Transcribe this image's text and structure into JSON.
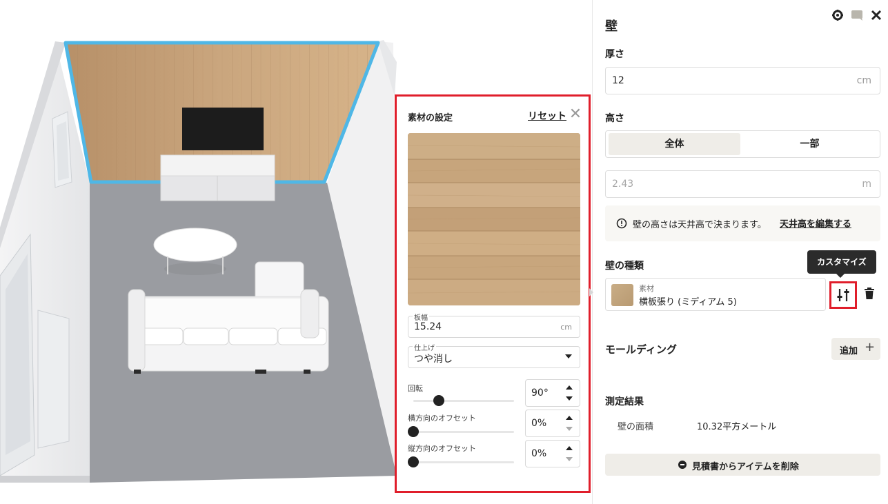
{
  "scene": {
    "name": "3d-room-view"
  },
  "material_panel": {
    "title": "素材の設定",
    "reset_label": "リセット",
    "close_glyph": "✕",
    "board_width": {
      "label": "板幅",
      "value": "15.24",
      "unit": "cm"
    },
    "finish": {
      "label": "仕上げ",
      "value": "つや消し"
    },
    "rotation": {
      "label": "回転",
      "value": "90°",
      "slider_fraction": 0.25
    },
    "horizontal_offset": {
      "label": "横方向のオフセット",
      "value": "0%",
      "slider_fraction": 0
    },
    "vertical_offset": {
      "label": "縦方向のオフセット",
      "value": "0%",
      "slider_fraction": 0
    }
  },
  "right_panel": {
    "title": "壁",
    "icons": [
      "gear-icon",
      "comment-icon",
      "close-icon"
    ],
    "thickness": {
      "label": "厚さ",
      "value": "12",
      "unit": "cm"
    },
    "height": {
      "label": "高さ",
      "options": [
        {
          "label": "全体",
          "active": true
        },
        {
          "label": "一部",
          "active": false
        }
      ],
      "value": "2.43",
      "unit": "m"
    },
    "info": {
      "text": "壁の高さは天井高で決まります。",
      "link": "天井高を編集する"
    },
    "wall_type": {
      "label": "壁の種類",
      "material_label": "素材",
      "material_value": "横板張り (ミディアム 5)",
      "tooltip": "カスタマイズ"
    },
    "molding": {
      "label": "モールディング",
      "add_label": "追加"
    },
    "measurement": {
      "label": "測定結果",
      "area_key": "壁の面積",
      "area_value": "10.32平方メートル"
    },
    "remove_label": "見積書からアイテムを削除"
  },
  "colors": {
    "accent_red": "#e01e2b",
    "wall_highlight": "#4fb7e6",
    "wood": "#c8a57c",
    "floor": "#9a9ca1"
  }
}
